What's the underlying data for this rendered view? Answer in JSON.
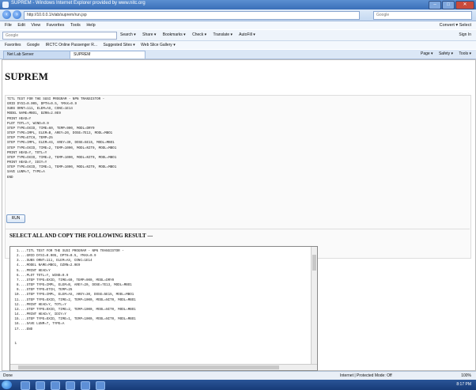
{
  "window": {
    "title": "SUPREM - Windows Internet Explorer provided by www.nitc.org"
  },
  "addressbar": {
    "url": "http://10.0.0.1/vlab/suprem/run.jsp",
    "search_placeholder": "Google"
  },
  "menu": {
    "items": [
      "File",
      "Edit",
      "View",
      "Favorites",
      "Tools",
      "Help"
    ],
    "right": "Convert ▾   Select"
  },
  "googlebar": {
    "search_label": "Google",
    "items": [
      "Search ▾",
      "Share ▾",
      "Bookmarks ▾",
      "Check ▾",
      "Translate ▾",
      "AutoFill ▾"
    ],
    "right": "Sign In"
  },
  "favbar": {
    "items": [
      "Favorites",
      "Google",
      "IRCTC Online Passenger R...",
      "Suggested Sites ▾",
      "Web Slice Gallery ▾"
    ]
  },
  "tabs": {
    "items": [
      "Net Lab Server",
      "SUPREM"
    ],
    "commands": [
      "Page ▾",
      "Safety ▾",
      "Tools ▾"
    ]
  },
  "page": {
    "title": "SUPREM",
    "input_deck": "TITL TEST FOR THE SUSI PROGRAM - NPN TRANSISTOR -\nGRID DYSI=0.005, DPTH=0.5, YMAX=0.9\nSUBS ORNT=111, ELEM=AS, CONC=1E14\nMODEL NAME=MBO1, DZRN=2.0E9\nPRINT HEAD=Y\nPLOT TOTL=Y, WIND=0.9\nSTEP TYPE=OXID, TIME=60, TEMP=900, MODL=DRY0\nSTEP TYPE=IMPL, ELEM=B, AREY=20, DOSE=7E13, MODL=MBO1\nSTEP TYPE=ETCH, TEMP=25\nSTEP TYPE=IMPL, ELEM=AS, AREY=30, DOSE=5E15, MODL=MBO1\nSTEP TYPE=OXID, TIME=2, TEMP=1000, MODL=NIT0, MODL=MBO1\nPRINT HEAD=Y, TOTL=Y\nSTEP TYPE=OXID, TIME=2, TEMP=1000, MODL=NIT0, MODL=MBO1\nPRINT HEAD=Y, IDIY=Y\nSTEP TYPE=OXID, TIME=1, TEMP=1000, MODL=NIT0, MODL=MBO1\nSAVE LUNM=7, TYPE=A\nEND",
    "run_label": "RUN",
    "result_heading": "SELECT ALL AND COPY THE FOLLOWING RESULT ---",
    "result_text": "  1....TITL TEST FOR THE SUSI PROGRAM - NPN TRANSISTOR -\n  2....GRID DYSI=0.005, DPTH=0.5, YMAX=0.9\n  3....SUBS ORNT=111, ELEM=AS, CONC=1E14\n  4....MODEL NAME=MBO1, DZRN=2.0E9\n  5....PRINT HEAD=Y\n  6....PLOT TOTL=Y, WIND=0.9\n  7....STEP TYPE=OXID, TIME=60, TEMP=900, MODL=DRY0\n  8....STEP TYPE=IMPL, ELEM=B, AREY=20, DOSE=7E13, MODL=MBO1\n  9....STEP TYPE=ETCH, TEMP=25\n 10....STEP TYPE=IMPL, ELEM=AS, AREY=30, DOSE=5E15, MODL=MBO1\n 11....STEP TYPE=OXID, TIME=2, TEMP=1000, MODL=NIT0, MODL=MBO1\n 12....PRINT HEAD=Y, TOTL=Y\n 13....STEP TYPE=OXID, TIME=2, TEMP=1000, MODL=NIT0, MODL=MBO1\n 14....PRINT HEAD=Y, IDIY=Y\n 15....STEP TYPE=OXID, TIME=1, TEMP=1000, MODL=NIT0, MODL=MBO1\n 16....SAVE LUNM=7, TYPE=A\n 17....END\n\n\n 1"
  },
  "status": {
    "left": "Done",
    "zone": "Internet | Protected Mode: Off",
    "zoom": "100%"
  },
  "taskbar": {
    "clock": "8:17 PM"
  },
  "colors": {
    "titlebar": "#3a6fb8",
    "run_border": "#7a9cc8"
  }
}
